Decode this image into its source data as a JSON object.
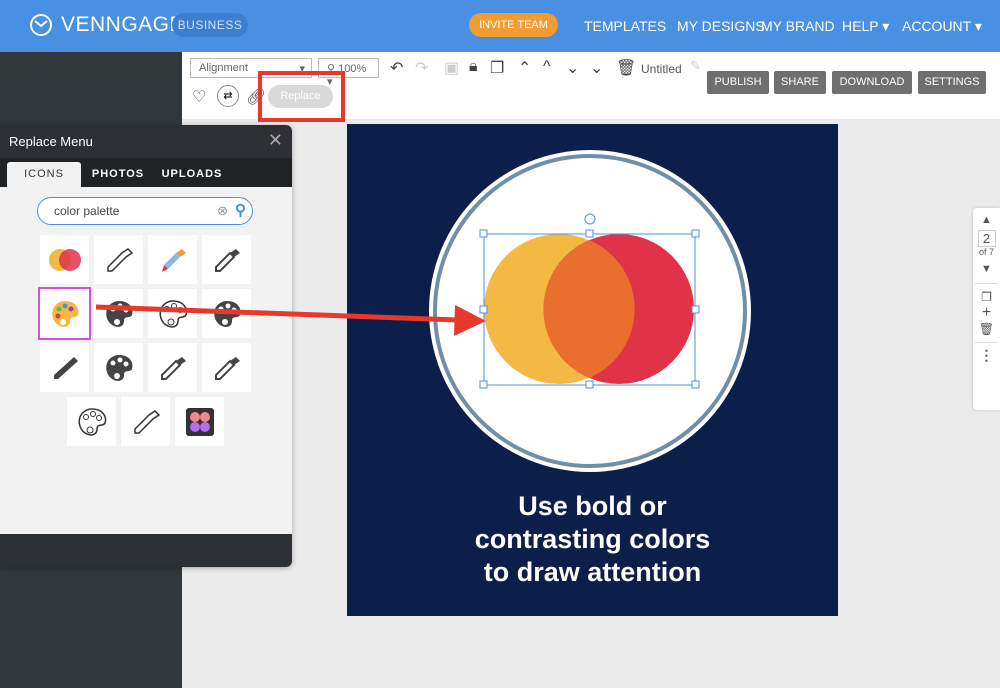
{
  "header": {
    "brand": "VENNGAGE",
    "plan_badge": "BUSINESS",
    "invite_label": "INVITE TEAM",
    "nav": [
      "TEMPLATES",
      "MY DESIGNS",
      "MY BRAND",
      "HELP ▾",
      "ACCOUNT ▾"
    ]
  },
  "toolbar": {
    "alignment": "Alignment",
    "zoom": "100%",
    "doc_title": "Untitled",
    "replace_label": "Replace",
    "buttons": [
      "PUBLISH",
      "SHARE",
      "DOWNLOAD",
      "SETTINGS"
    ]
  },
  "replace_menu": {
    "title": "Replace Menu",
    "tabs": [
      "ICONS",
      "PHOTOS",
      "UPLOADS"
    ],
    "active_tab": "ICONS",
    "search_value": "color palette",
    "results": [
      "venn-circles",
      "eyedropper-outline",
      "eyedropper-color",
      "eyedropper-dark",
      "palette-color",
      "palette-solid",
      "palette-outline",
      "palette-solid",
      "eyedropper-solid",
      "palette-solid",
      "eyedropper-outline-dark",
      "eyedropper-outline-dark",
      "palette-outline",
      "eyedropper-outline",
      "eyeshadow-palette"
    ],
    "selected_index": 4
  },
  "canvas": {
    "background": "#0c1f4a",
    "headline": [
      "Use bold or",
      "contrasting colors",
      "to draw attention"
    ],
    "venn_colors": [
      "#f4b942",
      "#e0334a",
      "#ea6f2f"
    ]
  },
  "page_control": {
    "current": "2",
    "total_label": "of 7"
  },
  "colors": {
    "brand_blue": "#4a90e2",
    "invite_orange": "#f39c32",
    "highlight_red": "#e8372b",
    "selection_magenta": "#d64fe0"
  }
}
